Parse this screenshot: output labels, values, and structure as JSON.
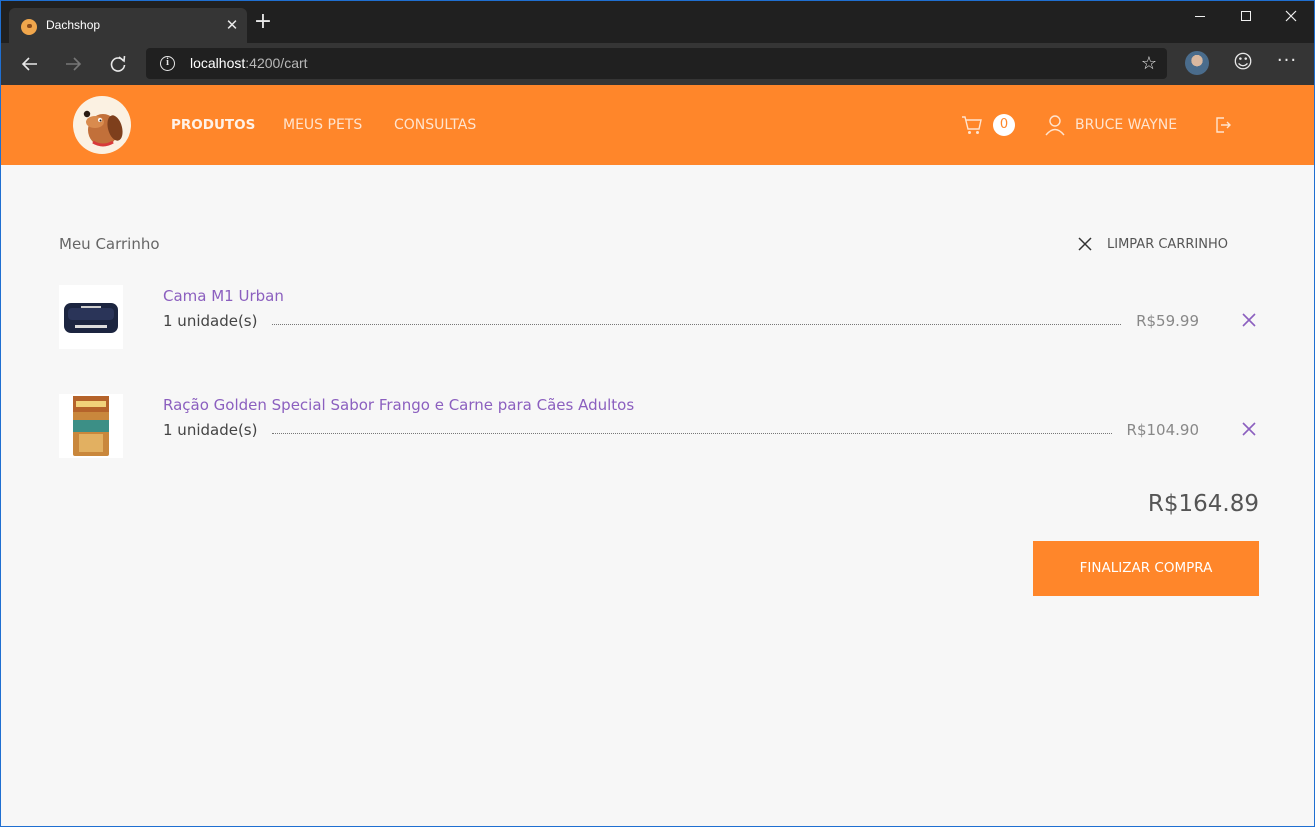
{
  "browser": {
    "tab_title": "Dachshop",
    "tab_close_glyph": "✕",
    "new_tab_glyph": "+",
    "url_host": "localhost",
    "url_path": ":4200/cart",
    "icons": [
      "back-arrow-icon",
      "forward-arrow-icon",
      "reload-icon",
      "info-icon",
      "star-icon",
      "profile-avatar",
      "emoji-icon",
      "more-icon"
    ]
  },
  "header": {
    "nav": [
      {
        "label": "PRODUTOS"
      },
      {
        "label": "MEUS PETS"
      },
      {
        "label": "CONSULTAS"
      }
    ],
    "cart_count": "0",
    "user_name": "BRUCE WAYNE",
    "colors": {
      "brand": "#ff862a"
    }
  },
  "cart": {
    "title": "Meu Carrinho",
    "clear_label": "LIMPAR CARRINHO",
    "items": [
      {
        "name": "Cama M1 Urban",
        "quantity": "1 unidade(s)",
        "price": "R$59.99"
      },
      {
        "name": "Ração Golden Special Sabor Frango e Carne para Cães Adultos",
        "quantity": "1 unidade(s)",
        "price": "R$104.90"
      }
    ],
    "total": "R$164.89",
    "checkout_label": "FINALIZAR COMPRA",
    "colors": {
      "item_name": "#8b5fbf",
      "remove_icon": "#8b5fbf"
    }
  }
}
